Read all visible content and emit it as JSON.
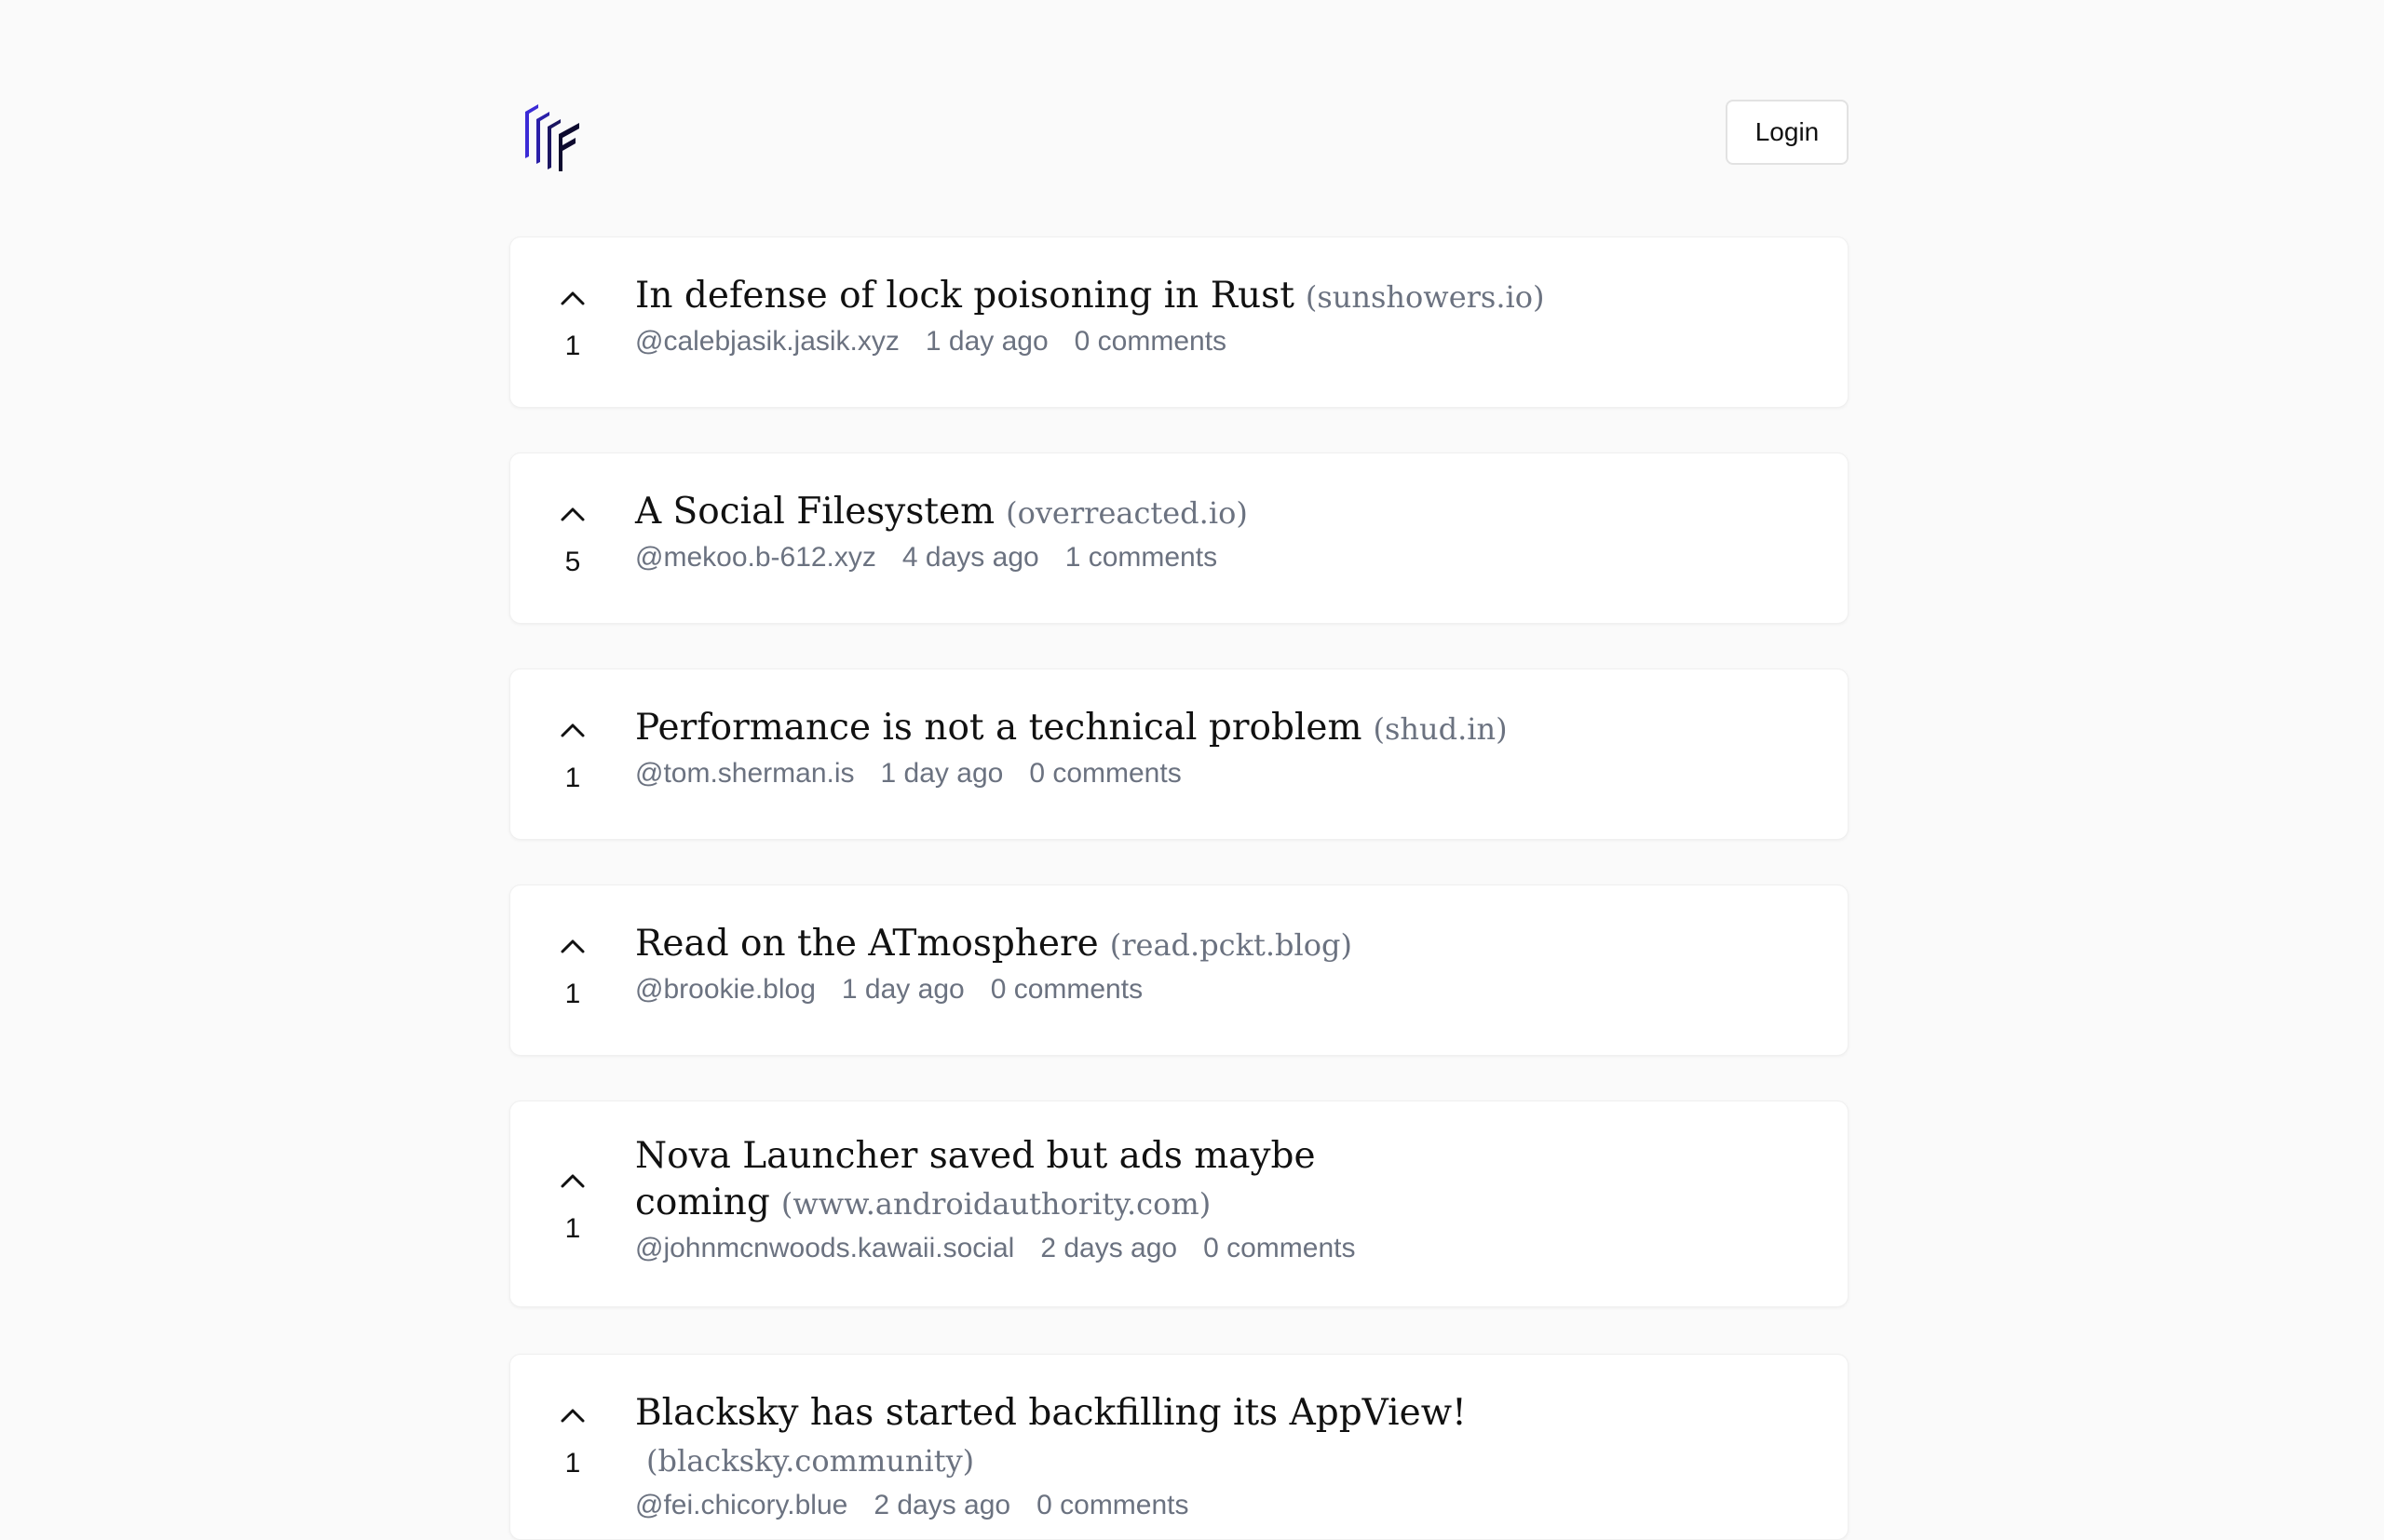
{
  "header": {
    "logo_name": "app-logo",
    "login_label": "Login"
  },
  "posts": [
    {
      "votes": "1",
      "title": "In defense of lock poisoning in Rust",
      "domain": "(sunshowers.io)",
      "author": "@calebjasik.jasik.xyz",
      "time": "1 day ago",
      "comments": "0 comments"
    },
    {
      "votes": "5",
      "title": "A Social Filesystem",
      "domain": "(overreacted.io)",
      "author": "@mekoo.b-612.xyz",
      "time": "4 days ago",
      "comments": "1 comments"
    },
    {
      "votes": "1",
      "title": "Performance is not a technical problem",
      "domain": "(shud.in)",
      "author": "@tom.sherman.is",
      "time": "1 day ago",
      "comments": "0 comments"
    },
    {
      "votes": "1",
      "title": "Read on the ATmosphere",
      "domain": "(read.pckt.blog)",
      "author": "@brookie.blog",
      "time": "1 day ago",
      "comments": "0 comments"
    },
    {
      "votes": "1",
      "title": "Nova Launcher saved but ads maybe coming",
      "domain": "(www.androidauthority.com)",
      "author": "@johnmcnwoods.kawaii.social",
      "time": "2 days ago",
      "comments": "0 comments"
    },
    {
      "votes": "1",
      "title": "Blacksky has started backfilling its AppView!",
      "domain": "(blacksky.community)",
      "author": "@fei.chicory.blue",
      "time": "2 days ago",
      "comments": "0 comments"
    }
  ]
}
